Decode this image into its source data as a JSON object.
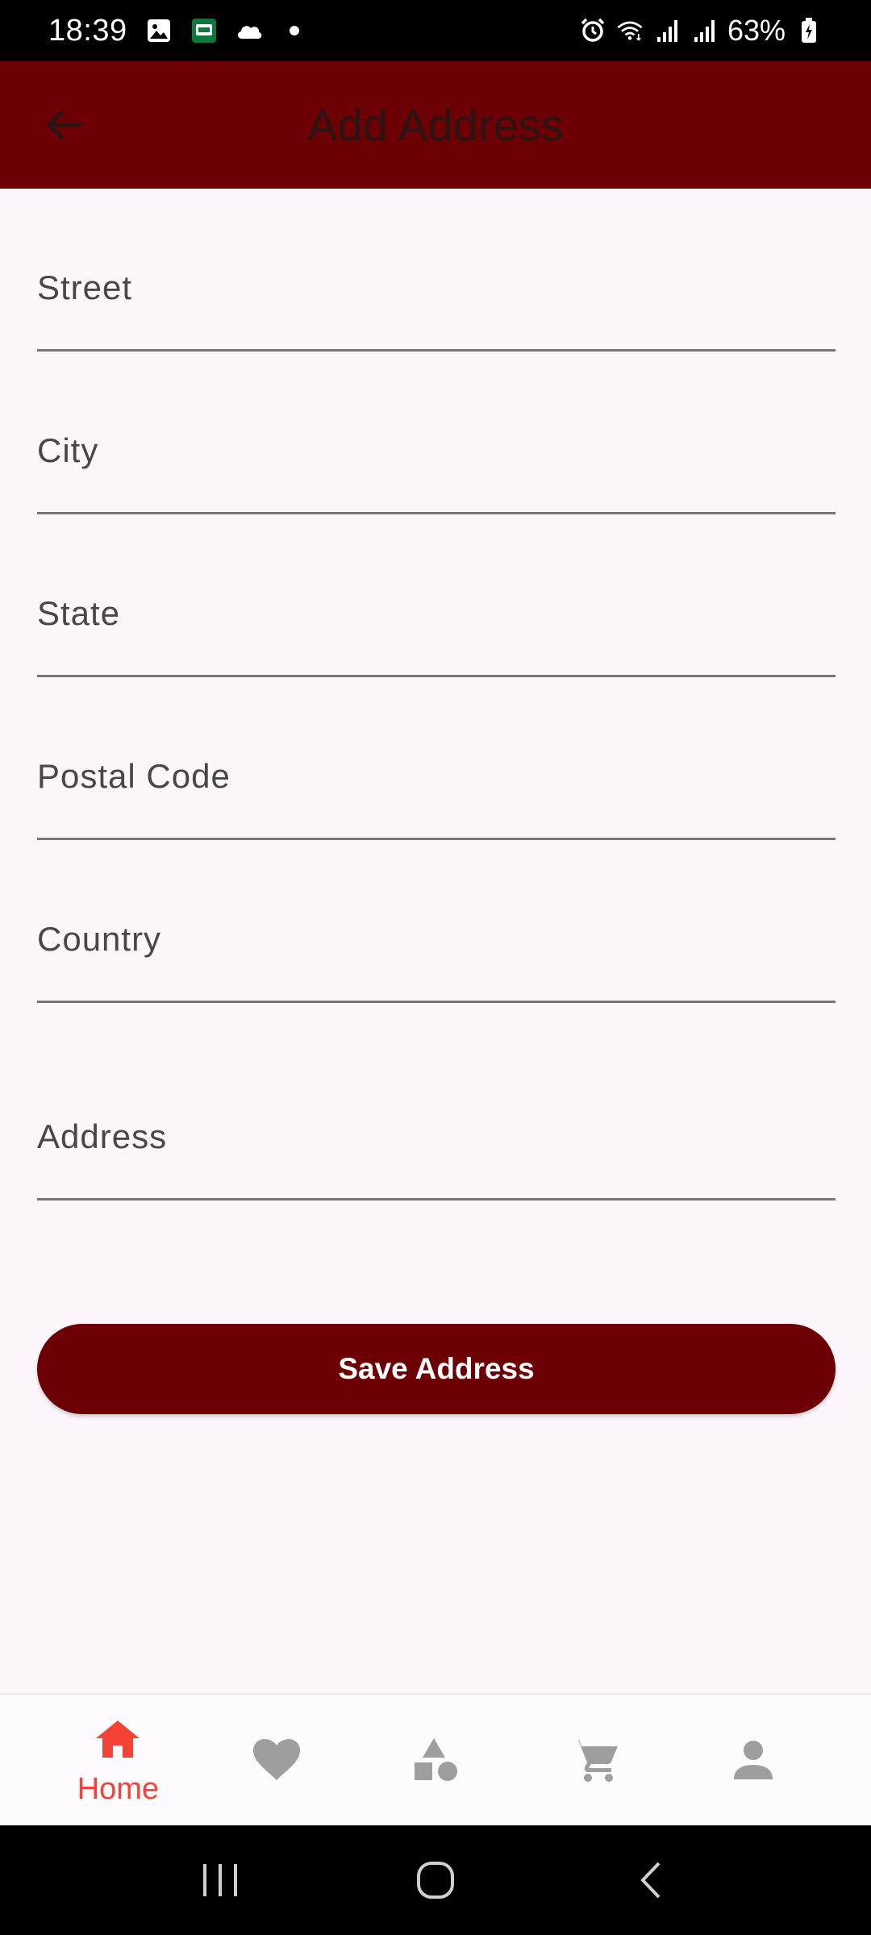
{
  "status_bar": {
    "time": "18:39",
    "battery": "63%",
    "icons": [
      "image-icon",
      "app-notification-icon",
      "cloud-icon",
      "dot-icon",
      "alarm-icon",
      "wifi-icon",
      "signal-icon",
      "signal-icon",
      "battery-charging-icon"
    ]
  },
  "app_bar": {
    "title": "Add Address",
    "back_icon": "arrow-back-icon",
    "background": "#6c0004"
  },
  "form": {
    "street_label": "Street",
    "city_label": "City",
    "state_label": "State",
    "postal_label": "Postal Code",
    "country_label": "Country",
    "address_label": "Address",
    "street_value": "",
    "city_value": "",
    "state_value": "",
    "postal_value": "",
    "country_value": "",
    "address_value": ""
  },
  "save_button": {
    "label": "Save Address",
    "color": "#6c0004"
  },
  "bottom_nav": {
    "active_color": "#f44336",
    "inactive_color": "#9e9e9e",
    "items": [
      {
        "label": "Home",
        "icon": "home-icon",
        "active": true
      },
      {
        "label": "",
        "icon": "heart-icon",
        "active": false
      },
      {
        "label": "",
        "icon": "categories-icon",
        "active": false
      },
      {
        "label": "",
        "icon": "cart-icon",
        "active": false
      },
      {
        "label": "",
        "icon": "person-icon",
        "active": false
      }
    ]
  },
  "system_nav": {
    "icons": [
      "recents-icon",
      "home-circle-icon",
      "back-chevron-icon"
    ]
  }
}
